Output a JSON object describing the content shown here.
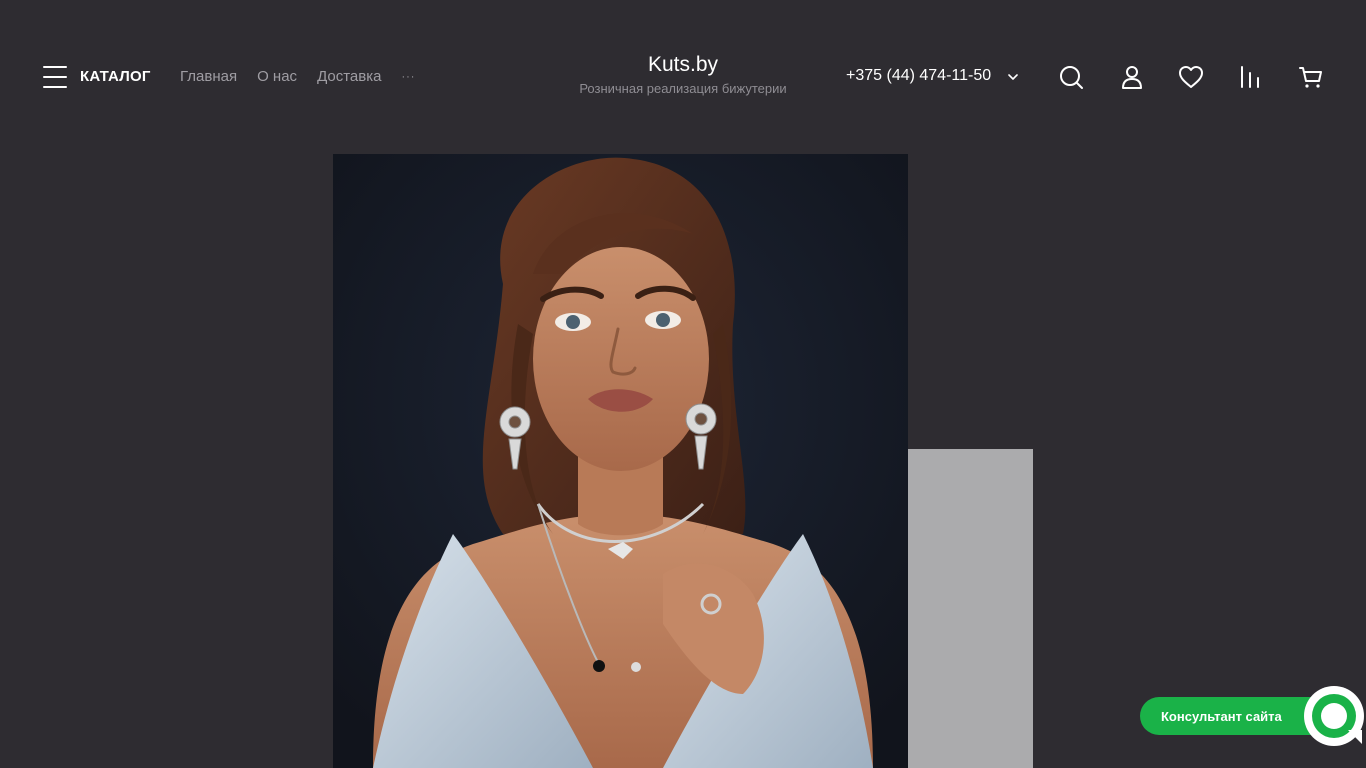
{
  "header": {
    "catalog_label": "КАТАЛОГ",
    "nav": [
      "Главная",
      "О нас",
      "Доставка"
    ],
    "nav_more": "···",
    "logo_title": "Kuts.by",
    "logo_subtitle": "Розничная реализация бижутерии",
    "phone": "+375 (44) 474-11-50",
    "icons": [
      "menu-icon",
      "chevron-down-icon",
      "search-icon",
      "user-icon",
      "heart-icon",
      "compare-icon",
      "cart-icon"
    ]
  },
  "widget": {
    "consultant_label": "Консультант сайта",
    "color": "#1ab248"
  },
  "colors": {
    "background": "#2e2c31",
    "side_panel": "#ababad"
  }
}
